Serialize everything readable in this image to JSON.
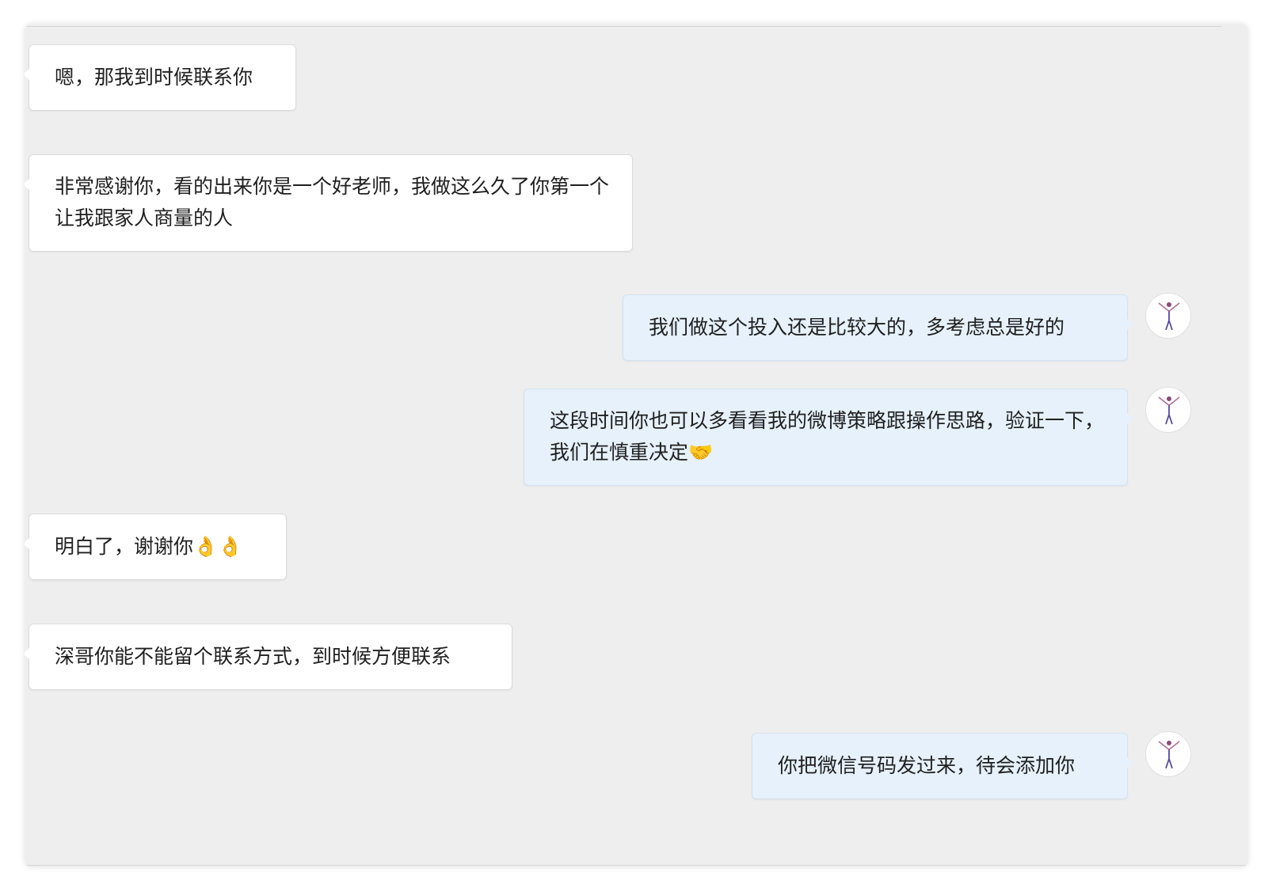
{
  "conversation": {
    "messages": [
      {
        "side": "left",
        "text": "嗯，那我到时候联系你"
      },
      {
        "side": "left",
        "text": "非常感谢你，看的出来你是一个好老师，我做这么久了你第一个让我跟家人商量的人"
      },
      {
        "side": "right",
        "text": "我们做这个投入还是比较大的，多考虑总是好的"
      },
      {
        "side": "right",
        "text": "这段时间你也可以多看看我的微博策略跟操作思路，验证一下，我们在慎重决定",
        "emoji": "handshake-emoji"
      },
      {
        "side": "left",
        "text": "明白了，谢谢你",
        "emoji": "pinched-hands-emoji"
      },
      {
        "side": "left",
        "text": "深哥你能不能留个联系方式，到时候方便联系"
      },
      {
        "side": "right",
        "text": "你把微信号码发过来，待会添加你"
      }
    ]
  },
  "colors": {
    "panel_background": "#eeeeee",
    "incoming_bubble": "#ffffff",
    "outgoing_bubble": "#e6f1fb",
    "text": "#1f1f1f"
  },
  "icons": {
    "avatar": "dancer-figure-avatar",
    "handshake": "🤝",
    "pinched_hands": "👌"
  }
}
